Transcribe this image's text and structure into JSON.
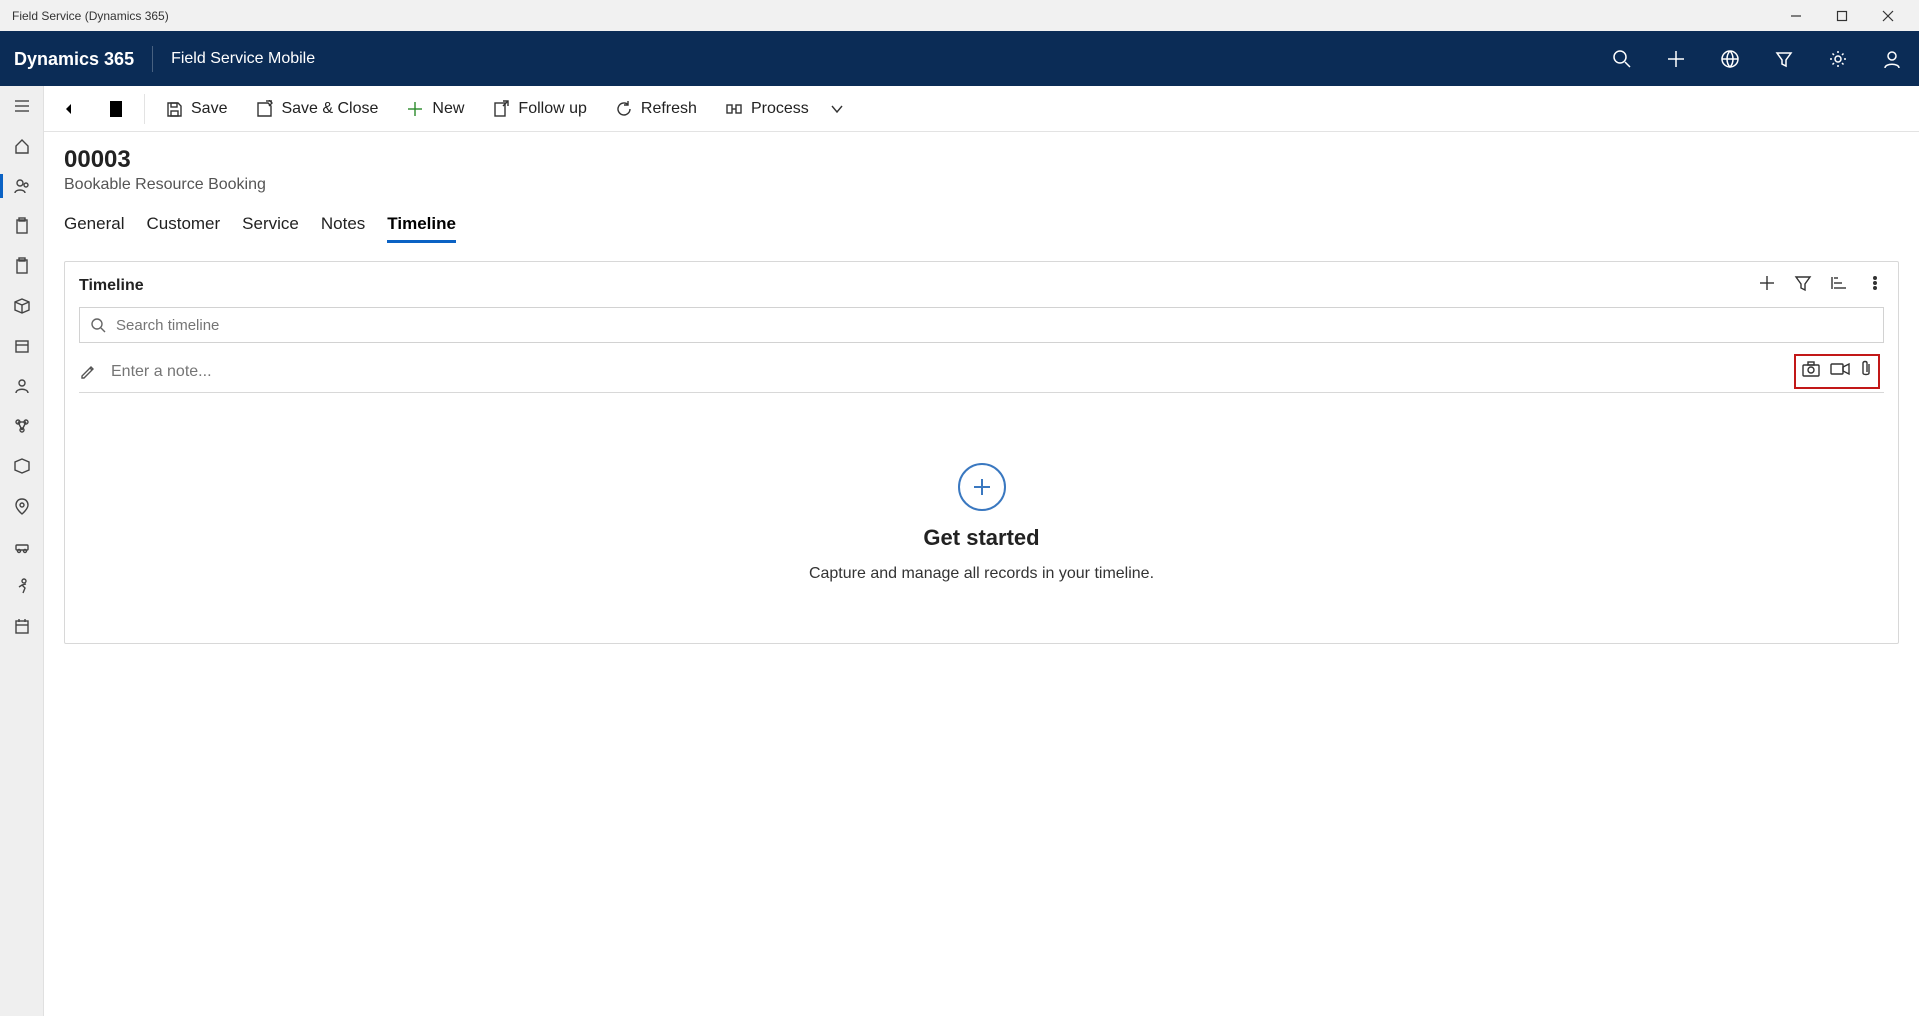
{
  "window": {
    "title": "Field Service (Dynamics 365)"
  },
  "header": {
    "brand": "Dynamics 365",
    "module": "Field Service Mobile"
  },
  "commands": {
    "save": "Save",
    "save_close": "Save & Close",
    "new": "New",
    "follow_up": "Follow up",
    "refresh": "Refresh",
    "process": "Process"
  },
  "record": {
    "title": "00003",
    "subtitle": "Bookable Resource Booking"
  },
  "tabs": [
    {
      "label": "General"
    },
    {
      "label": "Customer"
    },
    {
      "label": "Service"
    },
    {
      "label": "Notes"
    },
    {
      "label": "Timeline",
      "active": true
    }
  ],
  "timeline": {
    "panel_title": "Timeline",
    "search_placeholder": "Search timeline",
    "note_placeholder": "Enter a note...",
    "empty_title": "Get started",
    "empty_sub": "Capture and manage all records in your timeline."
  }
}
